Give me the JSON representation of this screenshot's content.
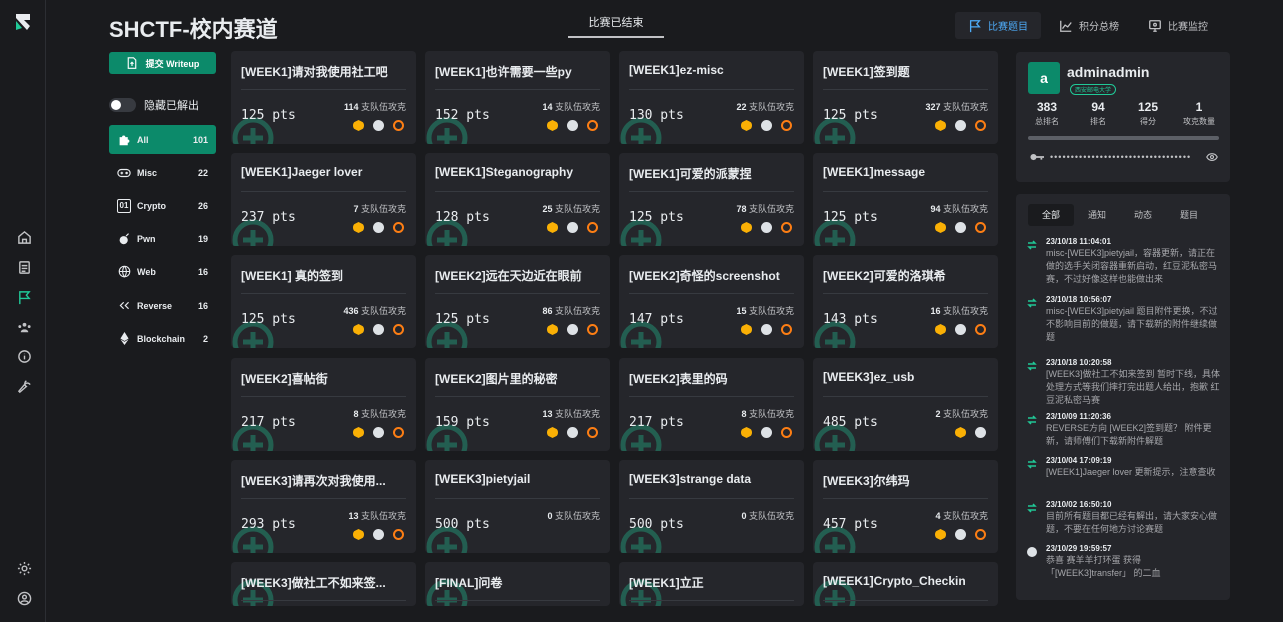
{
  "header": {
    "title": "SHCTF-校内赛道",
    "status_tab": "比赛已结束",
    "nav": [
      {
        "label": "比赛题目",
        "icon": "flag-icon",
        "active": true
      },
      {
        "label": "积分总榜",
        "icon": "chart-line-icon",
        "active": false
      },
      {
        "label": "比赛监控",
        "icon": "monitor-icon",
        "active": false
      }
    ]
  },
  "sidebar": {
    "submit_label": "提交 Writeup",
    "hide_solved_label": "隐藏已解出",
    "categories": [
      {
        "name": "All",
        "count": "101",
        "icon": "puzzle-icon"
      },
      {
        "name": "Misc",
        "count": "22",
        "icon": "gamepad-icon"
      },
      {
        "name": "Crypto",
        "count": "26",
        "icon": "binary-icon"
      },
      {
        "name": "Pwn",
        "count": "19",
        "icon": "bomb-icon"
      },
      {
        "name": "Web",
        "count": "16",
        "icon": "globe-icon"
      },
      {
        "name": "Reverse",
        "count": "16",
        "icon": "rewind-icon"
      },
      {
        "name": "Blockchain",
        "count": "2",
        "icon": "ethereum-icon"
      }
    ]
  },
  "challenges": [
    {
      "name": "[WEEK1]请对我使用社工吧",
      "pts": "125 pts",
      "solves": "114",
      "solves_label": "支队伍攻克"
    },
    {
      "name": "[WEEK1]也许需要一些py",
      "pts": "152 pts",
      "solves": "14",
      "solves_label": "支队伍攻克"
    },
    {
      "name": "[WEEK1]ez-misc",
      "pts": "130 pts",
      "solves": "22",
      "solves_label": "支队伍攻克"
    },
    {
      "name": "[WEEK1]签到题",
      "pts": "125 pts",
      "solves": "327",
      "solves_label": "支队伍攻克"
    },
    {
      "name": "[WEEK1]Jaeger lover",
      "pts": "237 pts",
      "solves": "7",
      "solves_label": "支队伍攻克"
    },
    {
      "name": "[WEEK1]Steganography",
      "pts": "128 pts",
      "solves": "25",
      "solves_label": "支队伍攻克"
    },
    {
      "name": "[WEEK1]可爱的派蒙捏",
      "pts": "125 pts",
      "solves": "78",
      "solves_label": "支队伍攻克"
    },
    {
      "name": "[WEEK1]message",
      "pts": "125 pts",
      "solves": "94",
      "solves_label": "支队伍攻克"
    },
    {
      "name": "[WEEK1] 真的签到",
      "pts": "125 pts",
      "solves": "436",
      "solves_label": "支队伍攻克"
    },
    {
      "name": "[WEEK2]远在天边近在眼前",
      "pts": "125 pts",
      "solves": "86",
      "solves_label": "支队伍攻克"
    },
    {
      "name": "[WEEK2]奇怪的screenshot",
      "pts": "147 pts",
      "solves": "15",
      "solves_label": "支队伍攻克"
    },
    {
      "name": "[WEEK2]可爱的洛琪希",
      "pts": "143 pts",
      "solves": "16",
      "solves_label": "支队伍攻克"
    },
    {
      "name": "[WEEK2]喜帖街",
      "pts": "217 pts",
      "solves": "8",
      "solves_label": "支队伍攻克"
    },
    {
      "name": "[WEEK2]图片里的秘密",
      "pts": "159 pts",
      "solves": "13",
      "solves_label": "支队伍攻克"
    },
    {
      "name": "[WEEK2]表里的码",
      "pts": "217 pts",
      "solves": "8",
      "solves_label": "支队伍攻克"
    },
    {
      "name": "[WEEK3]ez_usb",
      "pts": "485 pts",
      "solves": "2",
      "solves_label": "支队伍攻克"
    },
    {
      "name": "[WEEK3]请再次对我使用...",
      "pts": "293 pts",
      "solves": "13",
      "solves_label": "支队伍攻克"
    },
    {
      "name": "[WEEK3]pietyjail",
      "pts": "500 pts",
      "solves": "0",
      "solves_label": "支队伍攻克"
    },
    {
      "name": "[WEEK3]strange data",
      "pts": "500 pts",
      "solves": "0",
      "solves_label": "支队伍攻克"
    },
    {
      "name": "[WEEK3]尔纬玛",
      "pts": "457 pts",
      "solves": "4",
      "solves_label": "支队伍攻克"
    },
    {
      "name": "[WEEK3]做社工不如来签...",
      "pts": "",
      "solves": "",
      "solves_label": ""
    },
    {
      "name": "[FINAL]问卷",
      "pts": "",
      "solves": "",
      "solves_label": ""
    },
    {
      "name": "[WEEK1]立正",
      "pts": "",
      "solves": "",
      "solves_label": ""
    },
    {
      "name": "[WEEK1]Crypto_Checkin",
      "pts": "",
      "solves": "",
      "solves_label": ""
    }
  ],
  "profile": {
    "avatar_letter": "a",
    "username": "adminadmin",
    "badge": "西安邮电大学",
    "stats": [
      {
        "value": "383",
        "label": "总排名"
      },
      {
        "value": "94",
        "label": "排名"
      },
      {
        "value": "125",
        "label": "得分"
      },
      {
        "value": "1",
        "label": "攻克数量"
      }
    ],
    "token_mask": "••••••••••••••••••••••••••••••••••"
  },
  "notices": {
    "tabs": [
      "全部",
      "通知",
      "动态",
      "题目"
    ],
    "items": [
      {
        "time": "23/10/18 11:04:01",
        "text": "misc-[WEEK3]pietyjail，容器更新，请正在做的选手关闭容器重新启动，红豆泥私密马赛，不过好像这样也能做出来"
      },
      {
        "time": "23/10/18 10:56:07",
        "text": "misc-[WEEK3]pietyjail 题目附件更换，不过不影响目前的做题，请下载新的附件继续做题"
      },
      {
        "time": "23/10/18 10:20:58",
        "text": "[WEEK3]做社工不如来签到 暂时下线，具体处理方式等我们摔打完出题人给出，抱歉 红豆泥私密马赛"
      },
      {
        "time": "23/10/09 11:20:36",
        "text": "REVERSE方向 [WEEK2]签到题？ 附件更新，请师傅们下载新附件解题"
      },
      {
        "time": "23/10/04 17:09:19",
        "text": "[WEEK1]Jaeger lover 更新提示，注意查收"
      },
      {
        "time": "23/10/02 16:50:10",
        "text": "目前所有题目都已经有解出，请大家安心做题，不要在任何地方讨论赛题"
      },
      {
        "time": "23/10/29 19:59:57",
        "text": "恭喜 赛羊羊打环蛋 获得 「[WEEK3]transfer」 的二血"
      }
    ]
  }
}
